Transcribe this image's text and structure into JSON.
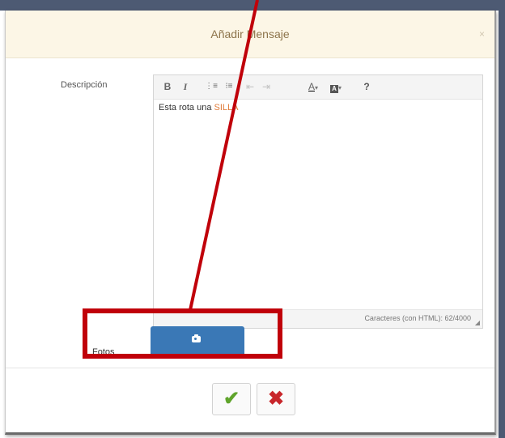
{
  "dialog": {
    "title": "Añadir Mensaje",
    "close_glyph": "×"
  },
  "form": {
    "description_label": "Descripción",
    "photos_label": "Fotos"
  },
  "toolbar": {
    "bold": "B",
    "italic": "I",
    "ordered_list": "⋮≡",
    "unordered_list": "⁝≡",
    "outdent": "⇤",
    "indent": "⇥",
    "font_color": "A",
    "bg_color": "A",
    "dropdown_caret": "▾",
    "help": "?"
  },
  "editor": {
    "text_plain": "Esta rota una ",
    "text_highlight": "SILLA",
    "counter": "Caracteres (con HTML): 62/4000",
    "resize_glyph": "◢"
  },
  "buttons": {
    "accept_glyph": "✔",
    "cancel_glyph": "✖"
  },
  "colors": {
    "header_bg": "#fcf6e6",
    "title": "#8d744b",
    "photo_button": "#3a78b6",
    "highlight_text": "#e07b39",
    "annotation": "#c0000a",
    "accept": "#5fa42b",
    "cancel": "#c8262b"
  }
}
